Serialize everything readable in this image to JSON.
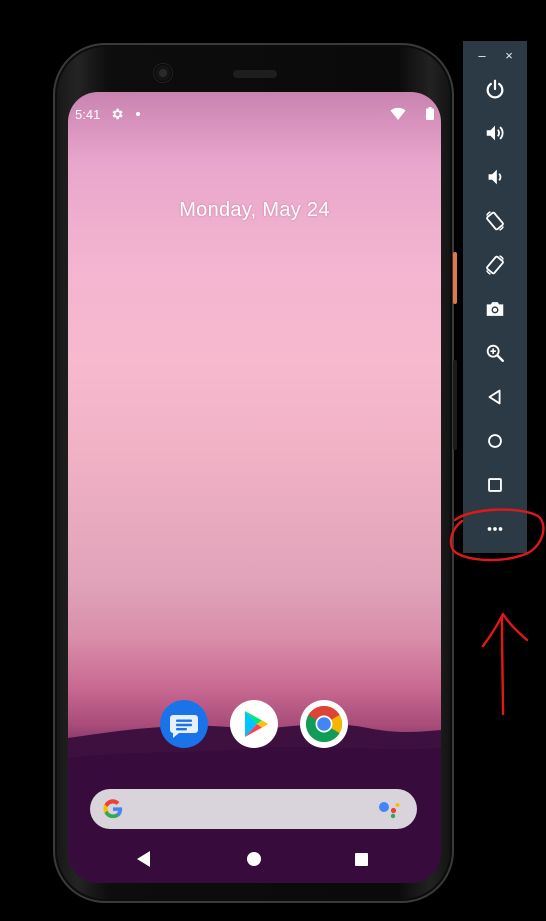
{
  "status_bar": {
    "time": "5:41"
  },
  "lock_screen": {
    "date": "Monday, May 24"
  },
  "dock": {
    "apps": [
      "messages-icon",
      "play-store-icon",
      "chrome-icon"
    ]
  },
  "emulator_toolbar": {
    "minimize_label": "–",
    "close_label": "×",
    "buttons": [
      "power-icon",
      "volume-up-icon",
      "volume-down-icon",
      "rotate-left-icon",
      "rotate-right-icon",
      "camera-icon",
      "zoom-icon",
      "back-icon",
      "home-icon",
      "overview-icon",
      "more-icon"
    ]
  },
  "colors": {
    "toolbar_bg": "#2c3a45",
    "annotation_red": "#e01818",
    "search_bar_bg": "#d9d3dc",
    "phone_accent_button": "#e0784a"
  }
}
